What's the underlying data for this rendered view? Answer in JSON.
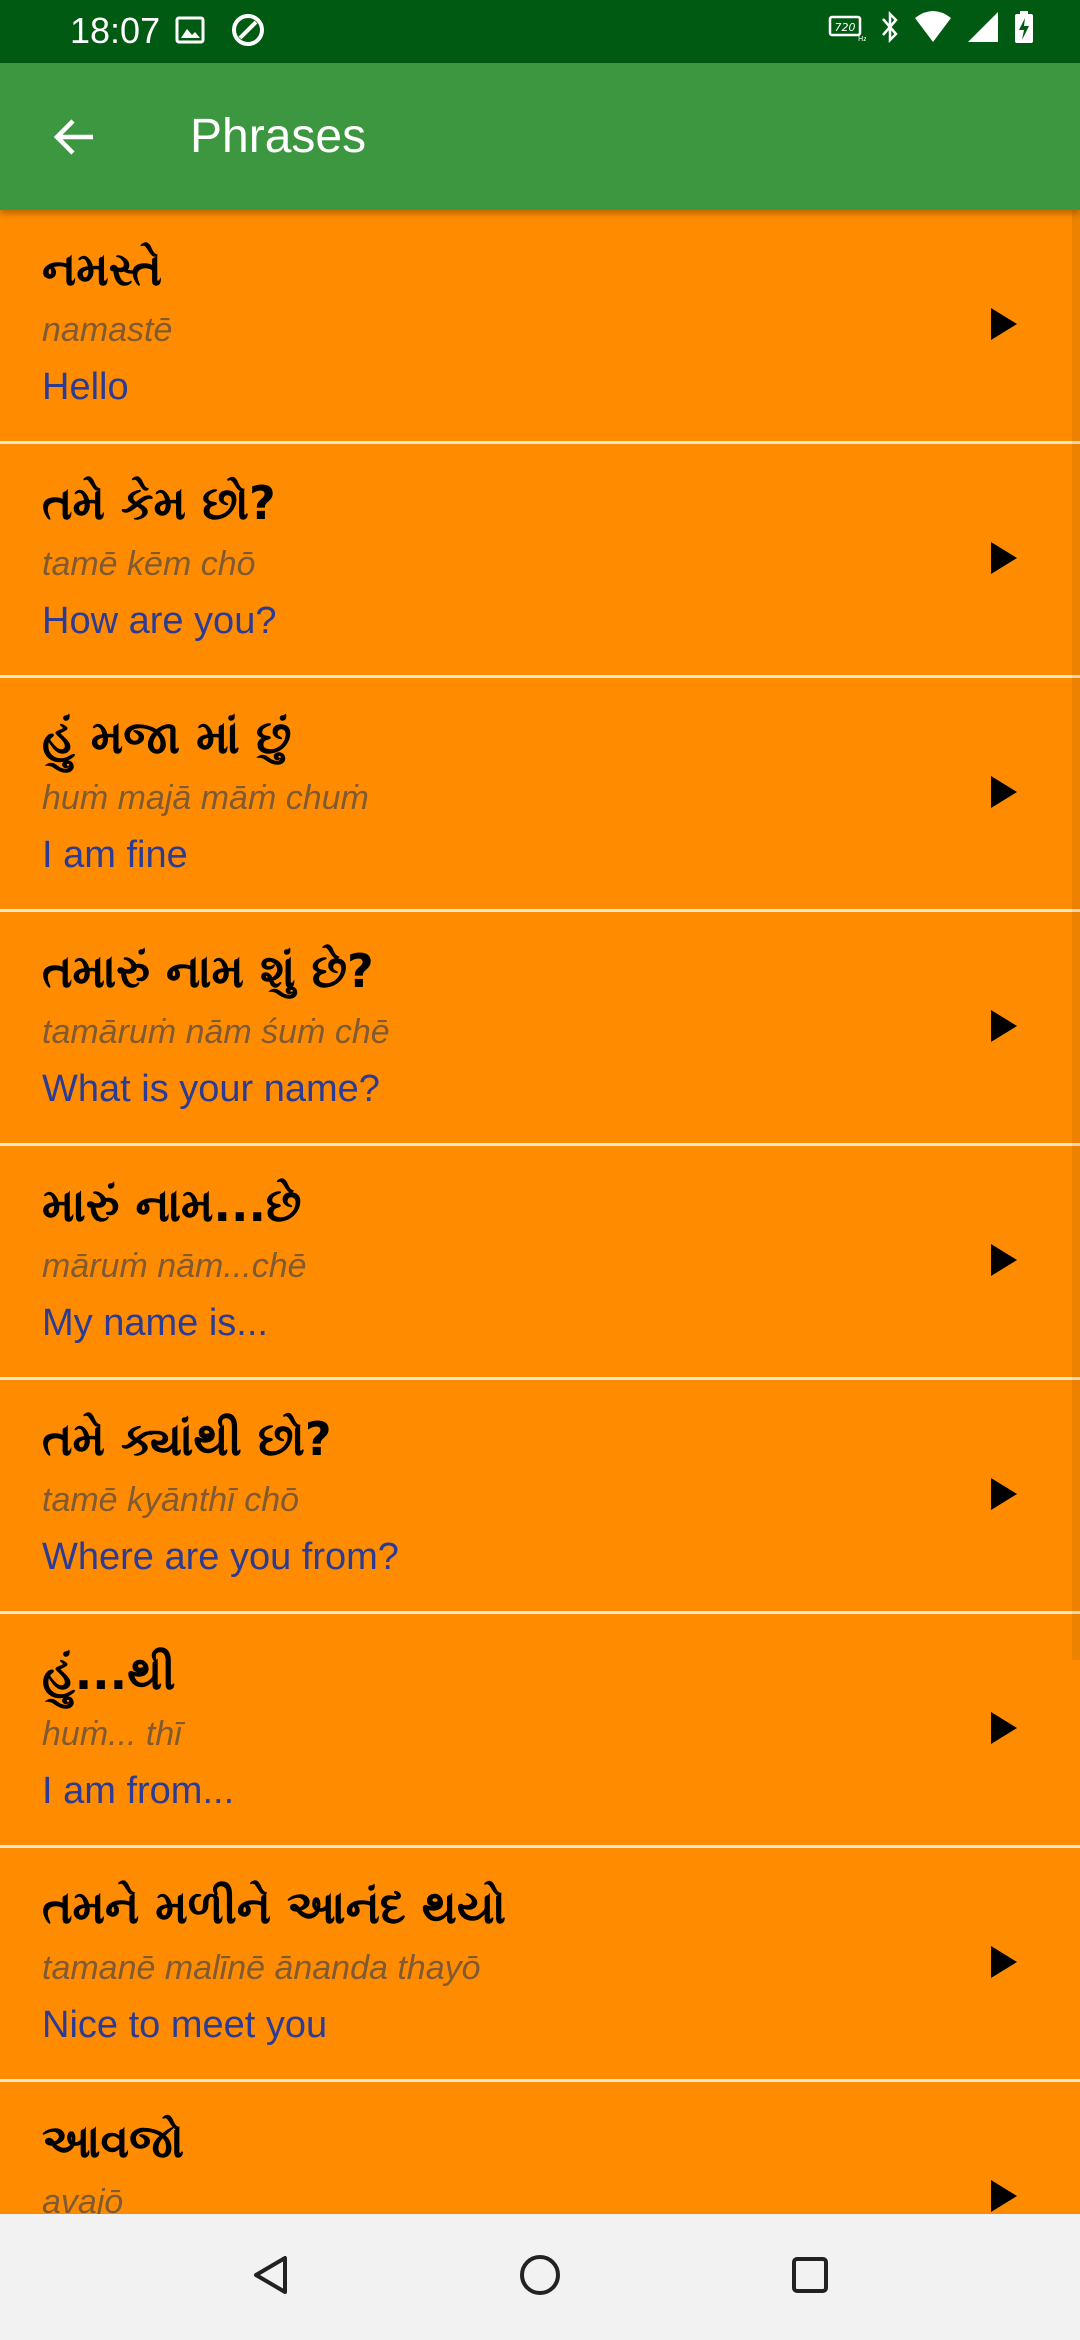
{
  "status_bar": {
    "time": "18:07",
    "left_icons": [
      "image-icon",
      "at-sign-icon"
    ],
    "right_icons": [
      "hd-voice-icon",
      "bluetooth-icon",
      "wifi-icon",
      "signal-icon",
      "battery-charging-icon"
    ]
  },
  "app_bar": {
    "title": "Phrases",
    "back_icon": "arrow-left-icon",
    "background": "#3d9640"
  },
  "colors": {
    "row_background": "#ff8c00",
    "native_text": "#000000",
    "translit_text": "#805a33",
    "english_text": "#2c3b93",
    "status_bar": "#005a12"
  },
  "phrases": [
    {
      "native": "નમસ્તે",
      "translit": "namastē",
      "english": "Hello",
      "icon": "play-icon"
    },
    {
      "native": "તમે કેમ છો?",
      "translit": "tamē kēm chō",
      "english": "How are you?",
      "icon": "play-icon"
    },
    {
      "native": "હું મજા માં છું",
      "translit": "huṁ majā māṁ chuṁ",
      "english": "I am fine",
      "icon": "play-icon"
    },
    {
      "native": "તમારું નામ શું છે?",
      "translit": "tamāruṁ nām śuṁ chē",
      "english": "What is your name?",
      "icon": "play-icon"
    },
    {
      "native": "મારું નામ...છે",
      "translit": "māruṁ nām...chē",
      "english": "My name is...",
      "icon": "play-icon"
    },
    {
      "native": "તમે ક્યાંથી છો?",
      "translit": "tamē kyānthī chō",
      "english": "Where are you from?",
      "icon": "play-icon"
    },
    {
      "native": "હું...થી",
      "translit": "huṁ... thī",
      "english": "I am from...",
      "icon": "play-icon"
    },
    {
      "native": "તમને મળીને આનંદ થયો",
      "translit": "tamanē malīnē ānanda thayō",
      "english": "Nice to meet you",
      "icon": "play-icon"
    },
    {
      "native": "આવજો",
      "translit": "avajō",
      "english": "",
      "icon": "play-icon"
    }
  ],
  "nav_bar": {
    "buttons": [
      "back-triangle-icon",
      "home-circle-icon",
      "recents-square-icon"
    ]
  }
}
